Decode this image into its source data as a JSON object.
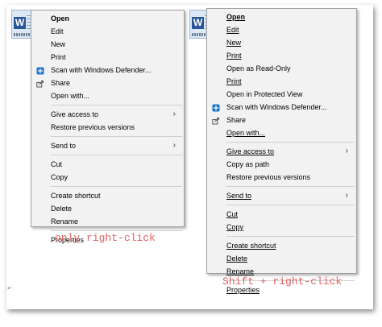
{
  "left_menu": {
    "items": [
      {
        "label": "Open",
        "bold": true
      },
      {
        "label": "Edit"
      },
      {
        "label": "New"
      },
      {
        "label": "Print"
      },
      {
        "label": "Scan with Windows Defender...",
        "icon": "defender-shield-icon"
      },
      {
        "label": "Share",
        "icon": "share-icon"
      },
      {
        "label": "Open with..."
      },
      {
        "sep": true
      },
      {
        "label": "Give access to",
        "submenu": true
      },
      {
        "label": "Restore previous versions"
      },
      {
        "sep": true
      },
      {
        "label": "Send to",
        "submenu": true
      },
      {
        "sep": true
      },
      {
        "label": "Cut"
      },
      {
        "label": "Copy"
      },
      {
        "sep": true
      },
      {
        "label": "Create shortcut"
      },
      {
        "label": "Delete"
      },
      {
        "label": "Rename"
      },
      {
        "sep": true
      },
      {
        "label": "Properties"
      }
    ]
  },
  "right_menu": {
    "items": [
      {
        "label": "Open",
        "bold": true,
        "underline": true
      },
      {
        "label": "Edit",
        "underline": true
      },
      {
        "label": "New",
        "underline": true
      },
      {
        "label": "Print",
        "underline": true
      },
      {
        "label": "Open as Read-Only"
      },
      {
        "label": "Print",
        "underline": true
      },
      {
        "label": "Open in Protected View"
      },
      {
        "label": "Scan with Windows Defender...",
        "icon": "defender-shield-icon"
      },
      {
        "label": "Share",
        "icon": "share-icon"
      },
      {
        "label": "Open with...",
        "underline": true
      },
      {
        "sep": true
      },
      {
        "label": "Give access to",
        "submenu": true,
        "underline": true
      },
      {
        "label": "Copy as path"
      },
      {
        "label": "Restore previous versions"
      },
      {
        "sep": true
      },
      {
        "label": "Send to",
        "submenu": true,
        "underline": true
      },
      {
        "sep": true
      },
      {
        "label": "Cut",
        "underline": true
      },
      {
        "label": "Copy",
        "underline": true
      },
      {
        "sep": true
      },
      {
        "label": "Create shortcut",
        "underline": true
      },
      {
        "label": "Delete",
        "underline": true
      },
      {
        "label": "Rename",
        "underline": true
      },
      {
        "sep": true
      },
      {
        "label": "Properties",
        "underline": true
      }
    ]
  },
  "captions": {
    "left": "only right-click",
    "right": "Shift + right-click"
  },
  "colors": {
    "caption": "#e06060",
    "menu_bg": "#f2f2f2",
    "word_blue": "#2b5797"
  },
  "icons": {
    "file": "word-document-icon",
    "file_letter": "W",
    "submenu": "chevron-right-icon"
  }
}
